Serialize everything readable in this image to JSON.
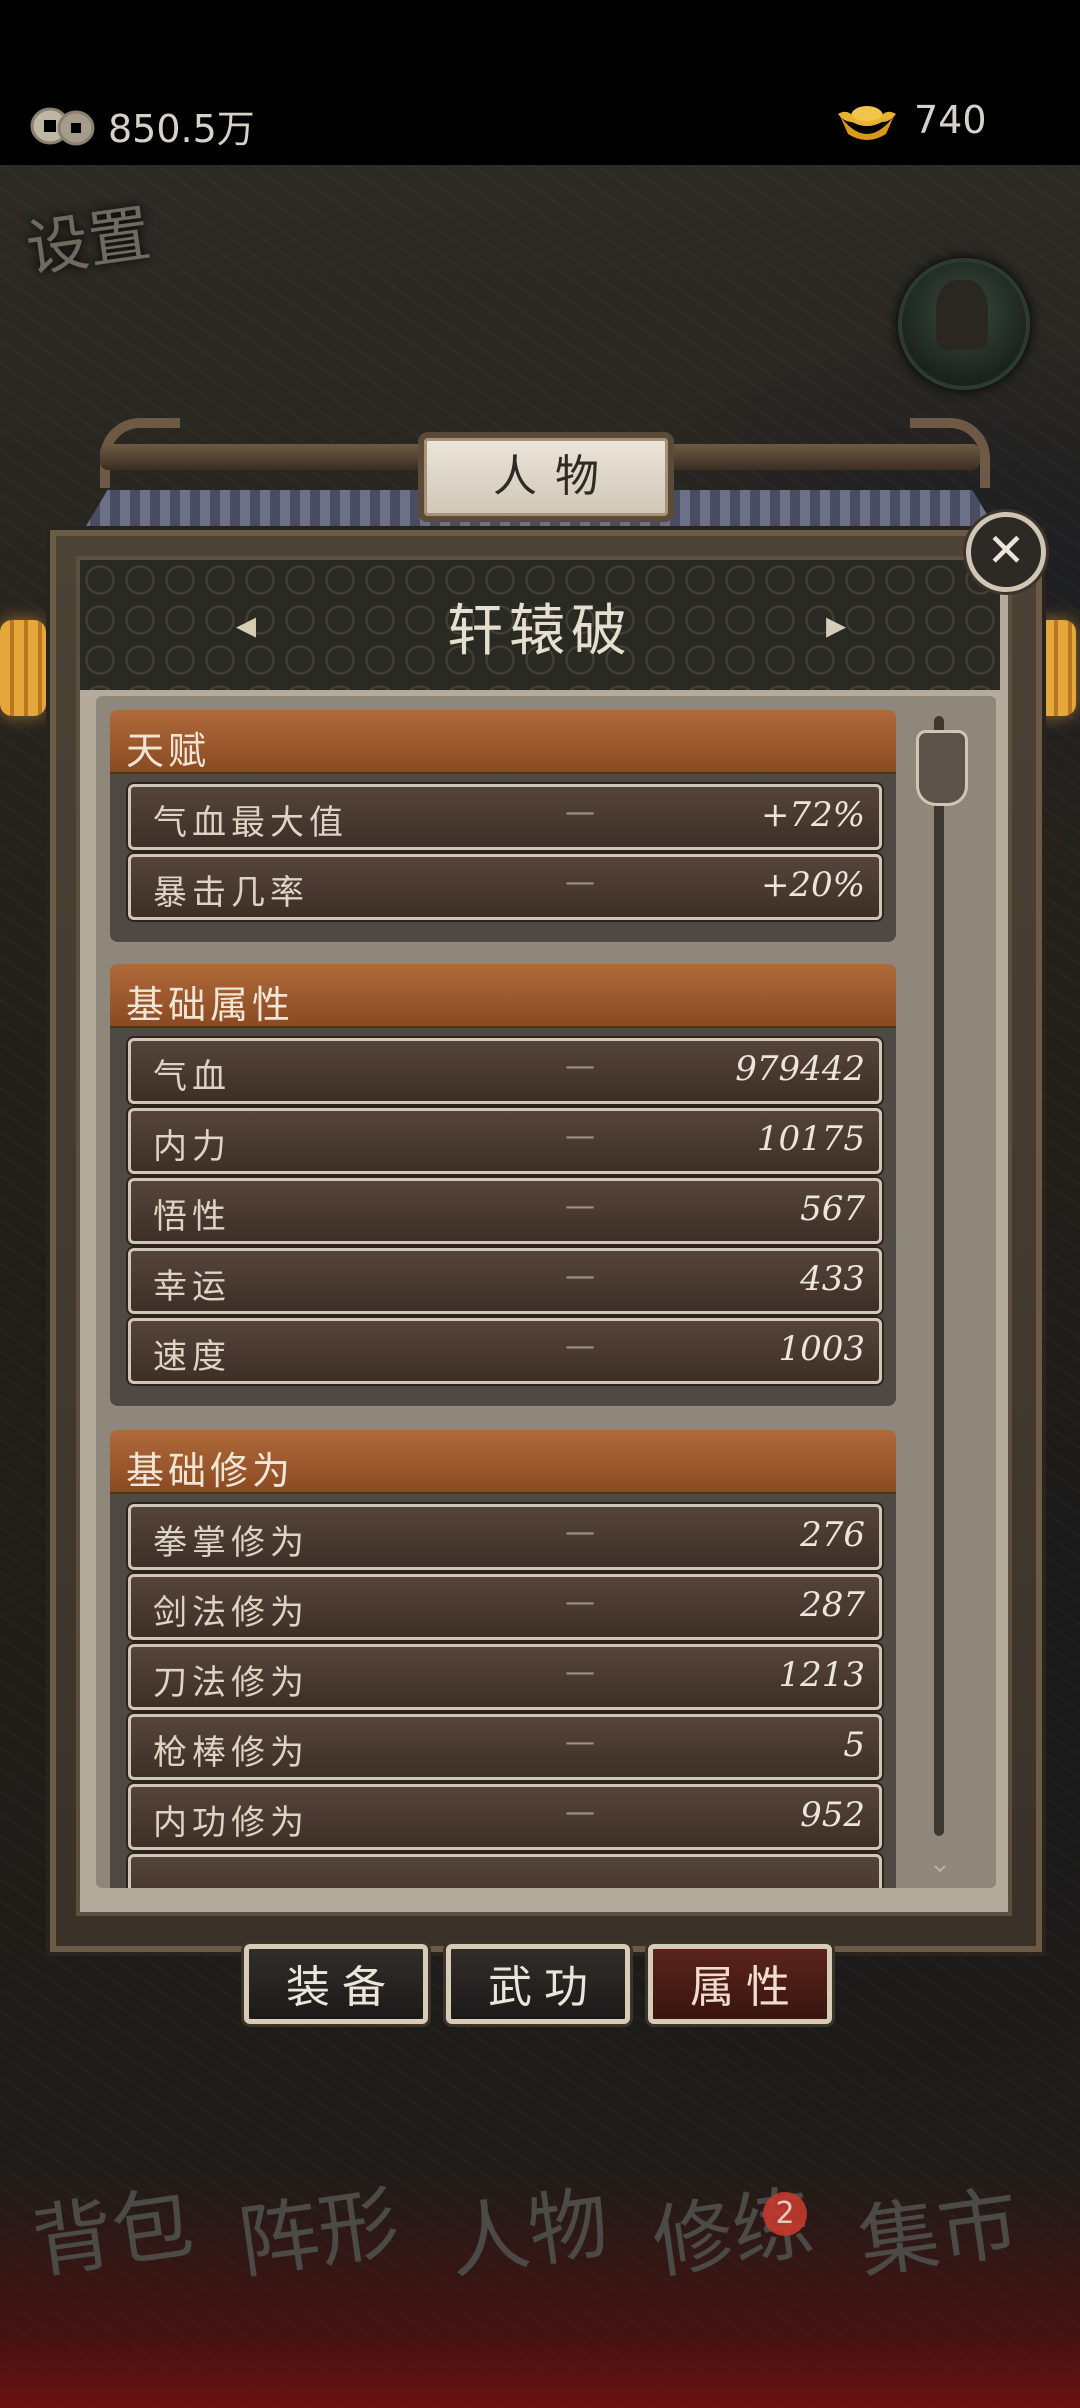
{
  "currency": {
    "coins": "850.5万",
    "ingots": "740"
  },
  "map": {
    "setting_label": "设置"
  },
  "panel": {
    "title": "人物",
    "character_name": "轩辕破",
    "prev_arrow": "◂",
    "next_arrow": "▸",
    "close": "✕"
  },
  "sections": [
    {
      "title": "天赋",
      "rows": [
        {
          "label": "气血最大值",
          "dash": "—",
          "value": "+72%"
        },
        {
          "label": "暴击几率",
          "dash": "—",
          "value": "+20%"
        }
      ]
    },
    {
      "title": "基础属性",
      "rows": [
        {
          "label": "气血",
          "dash": "—",
          "value": "979442"
        },
        {
          "label": "内力",
          "dash": "—",
          "value": "10175"
        },
        {
          "label": "悟性",
          "dash": "—",
          "value": "567"
        },
        {
          "label": "幸运",
          "dash": "—",
          "value": "433"
        },
        {
          "label": "速度",
          "dash": "—",
          "value": "1003"
        }
      ]
    },
    {
      "title": "基础修为",
      "rows": [
        {
          "label": "拳掌修为",
          "dash": "—",
          "value": "276"
        },
        {
          "label": "剑法修为",
          "dash": "—",
          "value": "287"
        },
        {
          "label": "刀法修为",
          "dash": "—",
          "value": "1213"
        },
        {
          "label": "枪棒修为",
          "dash": "—",
          "value": "5"
        },
        {
          "label": "内功修为",
          "dash": "—",
          "value": "952"
        }
      ]
    }
  ],
  "tabs": [
    {
      "label": "装备",
      "active": false
    },
    {
      "label": "武功",
      "active": false
    },
    {
      "label": "属性",
      "active": true
    }
  ],
  "bottom_nav": {
    "items": [
      "背包",
      "阵形",
      "人物",
      "修练",
      "集市"
    ],
    "badge": "2"
  },
  "colors": {
    "section_header": "#a35e32",
    "row_bg": "#4a3a31",
    "panel_bg": "#b4ab9c",
    "active_tab": "#5a241c"
  }
}
